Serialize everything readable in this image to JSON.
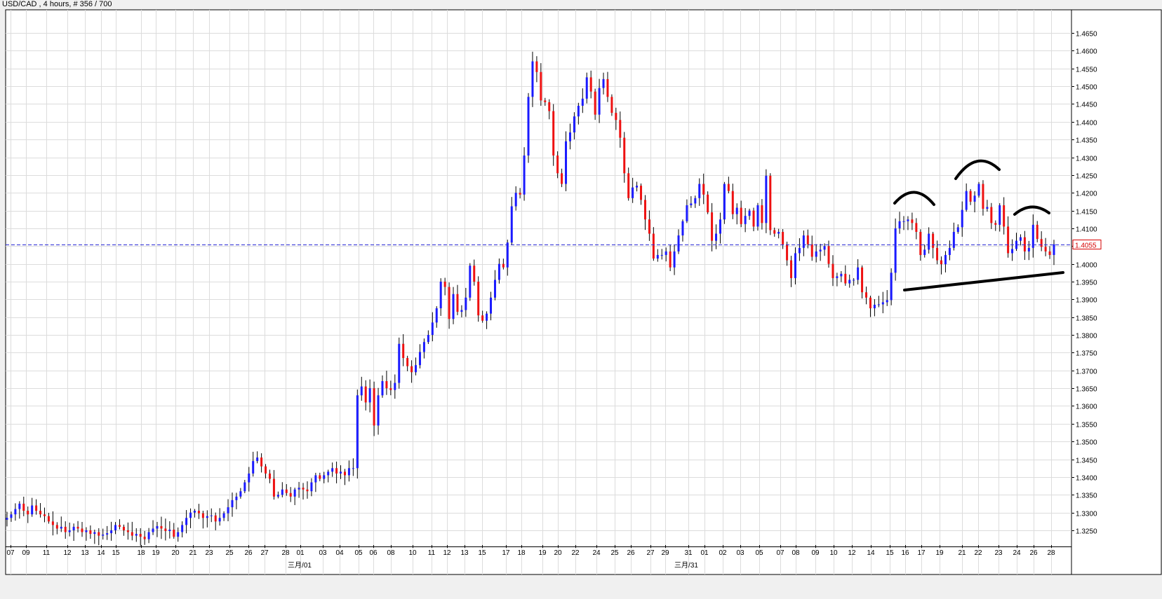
{
  "title": "USD/CAD , 4 hours, # 356 / 700",
  "colors": {
    "background": "#ffffff",
    "grid": "#dcdcdc",
    "up_candle": "#1a1aff",
    "down_candle": "#ee1111",
    "wick": "#000000",
    "price_line": "#2b2bd6",
    "price_badge_text": "#d60000",
    "annotation": "#000000"
  },
  "chart_data": {
    "type": "candlestick",
    "symbol": "USD/CAD",
    "timeframe": "4 hours",
    "bar_count": 356,
    "ylim": [
      1.322,
      1.467
    ],
    "y_ticks": [
      "1.4650",
      "1.4600",
      "1.4550",
      "1.4500",
      "1.4450",
      "1.4400",
      "1.4350",
      "1.4300",
      "1.4250",
      "1.4200",
      "1.4150",
      "1.4100",
      "1.4050",
      "1.4000",
      "1.3950",
      "1.3900",
      "1.3850",
      "1.3800",
      "1.3750",
      "1.3700",
      "1.3650",
      "1.3600",
      "1.3550",
      "1.3500",
      "1.3450",
      "1.3400",
      "1.3350",
      "1.3300",
      "1.3250"
    ],
    "x_ticks": [
      "07",
      "09",
      "11",
      "12",
      "13",
      "14",
      "15",
      "18",
      "19",
      "20",
      "21",
      "23",
      "25",
      "26",
      "27",
      "28",
      "01",
      "03",
      "04",
      "05",
      "06",
      "08",
      "10",
      "11",
      "12",
      "13",
      "15",
      "17",
      "18",
      "19",
      "20",
      "22",
      "24",
      "25",
      "26",
      "27",
      "29",
      "31",
      "01",
      "02",
      "03",
      "05",
      "07",
      "08",
      "09",
      "10",
      "12",
      "14",
      "15",
      "16",
      "17",
      "19",
      "21",
      "22",
      "23",
      "24",
      "26",
      "28"
    ],
    "month_labels": [
      "三月/01",
      "三月/31"
    ],
    "current_price": "1.4055",
    "closes": [
      1.3285,
      1.3295,
      1.331,
      1.3325,
      1.3305,
      1.3295,
      1.332,
      1.3305,
      1.3295,
      1.329,
      1.3275,
      1.3265,
      1.3255,
      1.326,
      1.3245,
      1.325,
      1.326,
      1.3255,
      1.3245,
      1.325,
      1.324,
      1.3245,
      1.3235,
      1.3238,
      1.3242,
      1.325,
      1.3265,
      1.326,
      1.325,
      1.3245,
      1.3235,
      1.324,
      1.3232,
      1.3225,
      1.3245,
      1.3255,
      1.3262,
      1.3255,
      1.3248,
      1.3252,
      1.3232,
      1.3245,
      1.3265,
      1.3285,
      1.33,
      1.3305,
      1.3298,
      1.3285,
      1.329,
      1.3292,
      1.3275,
      1.3285,
      1.3298,
      1.3315,
      1.3335,
      1.3345,
      1.336,
      1.3385,
      1.341,
      1.3445,
      1.3455,
      1.343,
      1.341,
      1.3395,
      1.3345,
      1.335,
      1.3365,
      1.3355,
      1.3345,
      1.3365,
      1.337,
      1.3365,
      1.336,
      1.3385,
      1.3405,
      1.3395,
      1.3405,
      1.3415,
      1.3425,
      1.341,
      1.3415,
      1.3405,
      1.3425,
      1.3425,
      1.363,
      1.3655,
      1.361,
      1.365,
      1.3545,
      1.363,
      1.367,
      1.365,
      1.3645,
      1.3665,
      1.3775,
      1.3735,
      1.3712,
      1.3695,
      1.3715,
      1.3752,
      1.378,
      1.38,
      1.3835,
      1.3875,
      1.395,
      1.3935,
      1.3845,
      1.3915,
      1.3865,
      1.387,
      1.3905,
      1.3995,
      1.395,
      1.3855,
      1.384,
      1.386,
      1.3905,
      1.3955,
      1.4,
      1.399,
      1.406,
      1.4162,
      1.42,
      1.4195,
      1.4305,
      1.447,
      1.457,
      1.454,
      1.446,
      1.4455,
      1.443,
      1.4305,
      1.4255,
      1.4225,
      1.4345,
      1.437,
      1.4415,
      1.4445,
      1.4465,
      1.4525,
      1.4485,
      1.442,
      1.4495,
      1.452,
      1.447,
      1.4425,
      1.4405,
      1.4355,
      1.4255,
      1.4185,
      1.4215,
      1.422,
      1.418,
      1.4125,
      1.4085,
      1.4015,
      1.4025,
      1.4025,
      1.4035,
      1.399,
      1.4035,
      1.408,
      1.412,
      1.4165,
      1.417,
      1.4185,
      1.4225,
      1.4195,
      1.4145,
      1.4065,
      1.4085,
      1.4125,
      1.4225,
      1.4205,
      1.414,
      1.4158,
      1.4112,
      1.4135,
      1.415,
      1.4105,
      1.4165,
      1.4115,
      1.4248,
      1.4095,
      1.4085,
      1.409,
      1.4055,
      1.401,
      1.396,
      1.403,
      1.4045,
      1.408,
      1.4055,
      1.402,
      1.4035,
      1.404,
      1.405,
      1.4,
      1.396,
      1.3965,
      1.3972,
      1.3945,
      1.3955,
      1.3955,
      1.399,
      1.392,
      1.3905,
      1.3875,
      1.3885,
      1.3886,
      1.3892,
      1.3898,
      1.3975,
      1.41,
      1.412,
      1.412,
      1.4125,
      1.4115,
      1.409,
      1.4025,
      1.404,
      1.4085,
      1.4045,
      1.401,
      1.3999,
      1.4025,
      1.4045,
      1.409,
      1.4103,
      1.4152,
      1.4205,
      1.4175,
      1.4192,
      1.4225,
      1.4155,
      1.416,
      1.4115,
      1.411,
      1.4165,
      1.4105,
      1.403,
      1.4042,
      1.4065,
      1.4075,
      1.4035,
      1.4045,
      1.411,
      1.407,
      1.4048,
      1.4035,
      1.4025,
      1.4055
    ]
  },
  "annotations": {
    "description_omitted": true
  }
}
